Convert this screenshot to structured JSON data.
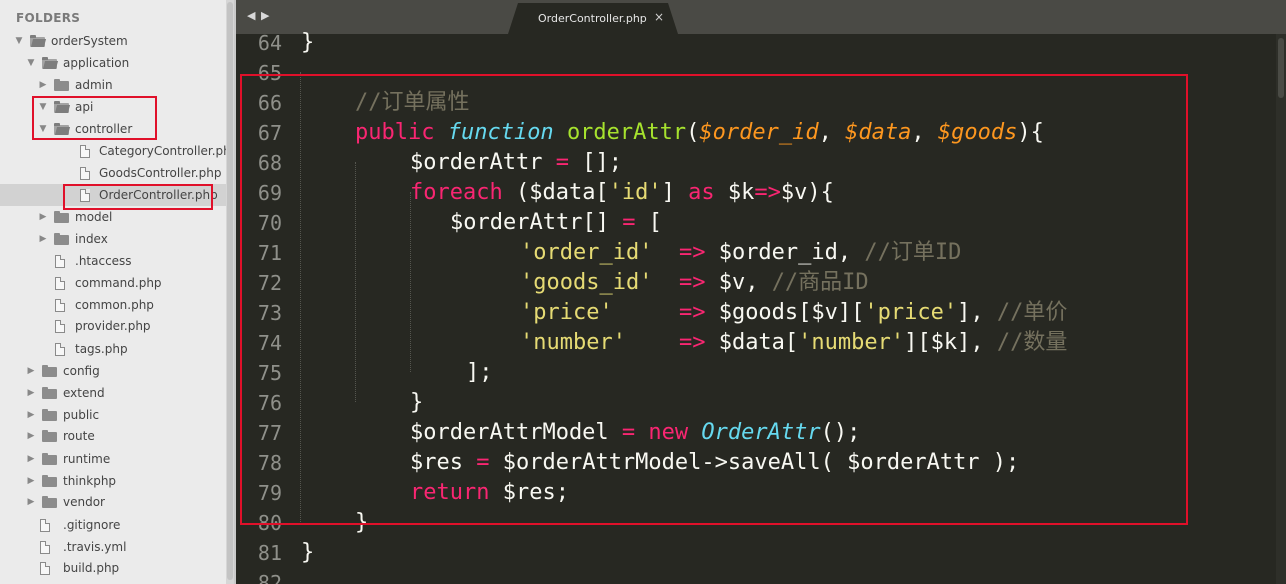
{
  "sidebar": {
    "header": "FOLDERS",
    "items": [
      {
        "label": "orderSystem",
        "type": "folder-open",
        "depth": 0
      },
      {
        "label": "application",
        "type": "folder-open",
        "depth": 1
      },
      {
        "label": "admin",
        "type": "folder",
        "depth": 2
      },
      {
        "label": "api",
        "type": "folder-open",
        "depth": 2
      },
      {
        "label": "controller",
        "type": "folder-open",
        "depth": 3
      },
      {
        "label": "CategoryController.php",
        "type": "file",
        "depth": 4
      },
      {
        "label": "GoodsController.php",
        "type": "file",
        "depth": 4
      },
      {
        "label": "OrderController.php",
        "type": "file",
        "depth": 4,
        "selected": true
      },
      {
        "label": "model",
        "type": "folder",
        "depth": 3
      },
      {
        "label": "index",
        "type": "folder",
        "depth": 2
      },
      {
        "label": ".htaccess",
        "type": "file",
        "depth": 2
      },
      {
        "label": "command.php",
        "type": "file",
        "depth": 2
      },
      {
        "label": "common.php",
        "type": "file",
        "depth": 2
      },
      {
        "label": "provider.php",
        "type": "file",
        "depth": 2
      },
      {
        "label": "tags.php",
        "type": "file",
        "depth": 2
      },
      {
        "label": "config",
        "type": "folder",
        "depth": 1
      },
      {
        "label": "extend",
        "type": "folder",
        "depth": 1
      },
      {
        "label": "public",
        "type": "folder",
        "depth": 1
      },
      {
        "label": "route",
        "type": "folder",
        "depth": 1
      },
      {
        "label": "runtime",
        "type": "folder",
        "depth": 1
      },
      {
        "label": "thinkphp",
        "type": "folder",
        "depth": 1
      },
      {
        "label": "vendor",
        "type": "folder",
        "depth": 1
      },
      {
        "label": ".gitignore",
        "type": "file",
        "depth": 1
      },
      {
        "label": ".travis.yml",
        "type": "file",
        "depth": 1
      },
      {
        "label": "build.php",
        "type": "file",
        "depth": 1
      }
    ]
  },
  "tabbar": {
    "back_arrow": "◀",
    "forward_arrow": "▶",
    "active_tab": "OrderController.php",
    "close_glyph": "×"
  },
  "editor": {
    "lines": [
      {
        "n": "64",
        "tokens": [
          [
            "p",
            "}"
          ]
        ]
      },
      {
        "n": "65",
        "tokens": []
      },
      {
        "n": "66",
        "tokens": [
          [
            "c",
            "//订单属性"
          ]
        ]
      },
      {
        "n": "67",
        "tokens": [
          [
            "k",
            "public "
          ],
          [
            "s",
            "function "
          ],
          [
            "f",
            "orderAttr"
          ],
          [
            "p",
            "("
          ],
          [
            "a",
            "$order_id"
          ],
          [
            "p",
            ", "
          ],
          [
            "a",
            "$data"
          ],
          [
            "p",
            ", "
          ],
          [
            "a",
            "$goods"
          ],
          [
            "p",
            "){"
          ]
        ]
      },
      {
        "n": "68",
        "tokens": [
          [
            "p",
            "$orderAttr "
          ],
          [
            "k",
            "="
          ],
          [
            "p",
            " [];"
          ]
        ]
      },
      {
        "n": "69",
        "tokens": [
          [
            "k",
            "foreach"
          ],
          [
            "p",
            " ($data["
          ],
          [
            "t",
            "'id'"
          ],
          [
            "p",
            "] "
          ],
          [
            "k",
            "as"
          ],
          [
            "p",
            " $k"
          ],
          [
            "k",
            "=>"
          ],
          [
            "p",
            "$v){"
          ]
        ]
      },
      {
        "n": "70",
        "tokens": [
          [
            "p",
            "$orderAttr[] "
          ],
          [
            "k",
            "="
          ],
          [
            "p",
            " ["
          ]
        ]
      },
      {
        "n": "71",
        "tokens": [
          [
            "t",
            "'order_id'"
          ],
          [
            "p",
            "  "
          ],
          [
            "k",
            "=>"
          ],
          [
            "p",
            " $order_id, "
          ],
          [
            "c",
            "//订单ID"
          ]
        ]
      },
      {
        "n": "72",
        "tokens": [
          [
            "t",
            "'goods_id'"
          ],
          [
            "p",
            "  "
          ],
          [
            "k",
            "=>"
          ],
          [
            "p",
            " $v, "
          ],
          [
            "c",
            "//商品ID"
          ]
        ]
      },
      {
        "n": "73",
        "tokens": [
          [
            "t",
            "'price'"
          ],
          [
            "p",
            "     "
          ],
          [
            "k",
            "=>"
          ],
          [
            "p",
            " $goods[$v]["
          ],
          [
            "t",
            "'price'"
          ],
          [
            "p",
            "], "
          ],
          [
            "c",
            "//单价"
          ]
        ]
      },
      {
        "n": "74",
        "tokens": [
          [
            "t",
            "'number'"
          ],
          [
            "p",
            "    "
          ],
          [
            "k",
            "=>"
          ],
          [
            "p",
            " $data["
          ],
          [
            "t",
            "'number'"
          ],
          [
            "p",
            "][$k], "
          ],
          [
            "c",
            "//数量"
          ]
        ]
      },
      {
        "n": "75",
        "tokens": [
          [
            "p",
            "];"
          ]
        ]
      },
      {
        "n": "76",
        "tokens": [
          [
            "p",
            "}"
          ]
        ]
      },
      {
        "n": "77",
        "tokens": [
          [
            "p",
            "$orderAttrModel "
          ],
          [
            "k",
            "="
          ],
          [
            "p",
            " "
          ],
          [
            "k",
            "new "
          ],
          [
            "s",
            "OrderAttr"
          ],
          [
            "p",
            "();"
          ]
        ]
      },
      {
        "n": "78",
        "tokens": [
          [
            "p",
            "$res "
          ],
          [
            "k",
            "="
          ],
          [
            "p",
            " $orderAttrModel->saveAll( $orderAttr );"
          ]
        ]
      },
      {
        "n": "79",
        "tokens": [
          [
            "k",
            "return"
          ],
          [
            "p",
            " $res;"
          ]
        ]
      },
      {
        "n": "80",
        "tokens": [
          [
            "p",
            "}"
          ]
        ]
      },
      {
        "n": "81",
        "tokens": [
          [
            "p",
            "}"
          ]
        ]
      },
      {
        "n": "82",
        "tokens": []
      }
    ]
  },
  "colors": {
    "highlight_box": "#e0102a",
    "editor_bg": "#272822",
    "keyword": "#f92672",
    "storage": "#66d9ef",
    "function": "#a6e22e",
    "parameter": "#fd971f",
    "string": "#e6db74",
    "comment": "#75715e"
  }
}
